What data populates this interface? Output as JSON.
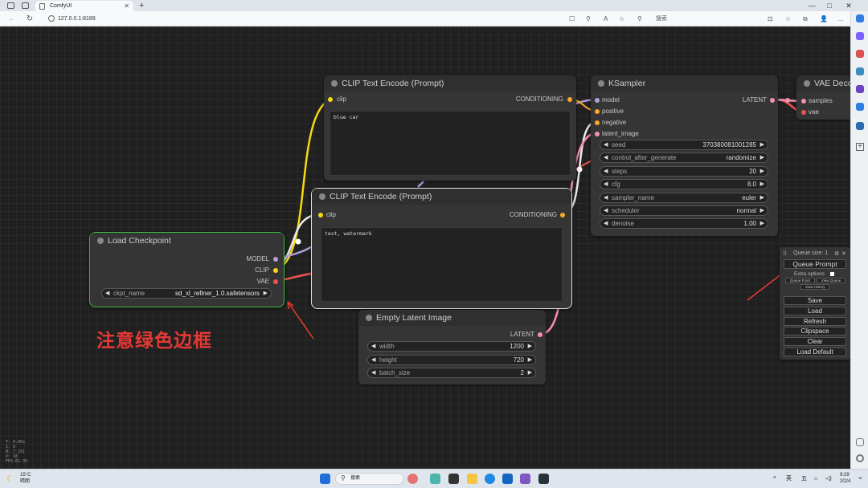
{
  "browser": {
    "tab_title": "ComfyUI",
    "new_tab": "+",
    "address": "127.0.0.1:8188",
    "search_label": "搜索",
    "nav_back": "←",
    "nav_refresh": "↻",
    "minimize": "—",
    "maximize": "□",
    "close": "✕",
    "tools": [
      "☐",
      "⚲",
      "A",
      "☆",
      "⊡",
      "☆",
      "⧉",
      "👤",
      "…"
    ]
  },
  "nodes": {
    "load_checkpoint": {
      "title": "Load Checkpoint",
      "outputs": [
        "MODEL",
        "CLIP",
        "VAE"
      ],
      "widget": {
        "label": "ckpt_name",
        "value": "sd_xl_refiner_1.0.safetensors"
      }
    },
    "clip_pos": {
      "title": "CLIP Text Encode (Prompt)",
      "input": "clip",
      "output": "CONDITIONING",
      "text": "blue car"
    },
    "clip_neg": {
      "title": "CLIP Text Encode (Prompt)",
      "input": "clip",
      "output": "CONDITIONING",
      "text": "text, watermark"
    },
    "empty_latent": {
      "title": "Empty Latent Image",
      "output": "LATENT",
      "widgets": [
        {
          "label": "width",
          "value": "1200"
        },
        {
          "label": "height",
          "value": "720"
        },
        {
          "label": "batch_size",
          "value": "2"
        }
      ]
    },
    "ksampler": {
      "title": "KSampler",
      "inputs": [
        "model",
        "positive",
        "negative",
        "latent_image"
      ],
      "output": "LATENT",
      "widgets": [
        {
          "label": "seed",
          "value": "370380081001285"
        },
        {
          "label": "control_after_generate",
          "value": "randomize"
        },
        {
          "label": "steps",
          "value": "20"
        },
        {
          "label": "cfg",
          "value": "8.0"
        },
        {
          "label": "sampler_name",
          "value": "euler"
        },
        {
          "label": "scheduler",
          "value": "normal"
        },
        {
          "label": "denoise",
          "value": "1.00"
        }
      ]
    },
    "vae_decode": {
      "title": "VAE Deco",
      "inputs": [
        "samples",
        "vae"
      ]
    }
  },
  "annotation": "注意绿色边框",
  "queue": {
    "size_label": "Queue size: 1",
    "queue_prompt": "Queue Prompt",
    "extra_options": "Extra options",
    "queue_front": "Queue Front",
    "view_queue": "View Queue",
    "view_history": "View History",
    "buttons": [
      "Save",
      "Load",
      "Refresh",
      "Clipspace",
      "Clear",
      "Load Default"
    ]
  },
  "stats": [
    "T: 0.00s",
    "I: 0",
    "N: 7 [0]",
    "V: 18",
    "FPS:61.35"
  ],
  "taskbar": {
    "weather_temp": "15°C",
    "weather_desc": "晴朗",
    "search": "搜索",
    "ime_1": "英",
    "ime_2": "五",
    "time": "9:29",
    "date": "2024"
  },
  "colors": {
    "canvas_bg": "#202020",
    "node_bg": "#353535",
    "selected_green": "#3fb83f",
    "selected_white": "#e0e0e0",
    "wire_clip": "#f5d80f",
    "wire_model": "#b39ddb",
    "wire_vae": "#ef5350",
    "wire_cond": "#ffa726",
    "wire_latent": "#f48fb1",
    "annotation_red": "#e53935"
  }
}
